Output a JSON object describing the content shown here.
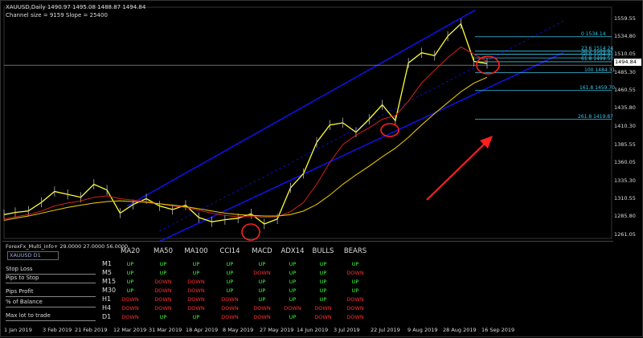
{
  "header": {
    "symbol_line": "XAUUSD,Daily  1490.97 1495.08 1488.87 1494.84",
    "channel_line": "Channel size = 9159 Slope = 25400"
  },
  "colors": {
    "price_line": "#ffff33",
    "ma_fast": "#d42020",
    "ma_slow": "#e0c000",
    "channel": "#1010e0",
    "fib": "#39c5e8",
    "annotation": "#ff2020",
    "up": "#33ff33",
    "down": "#ff3030"
  },
  "chart_data": {
    "type": "line",
    "title": "",
    "symbol": "XAUUSD",
    "timeframe": "Daily",
    "ohlc_last": {
      "open": 1490.97,
      "high": 1495.08,
      "low": 1488.87,
      "close": 1494.84
    },
    "current_price": "1494.84",
    "ylim": [
      1255,
      1575
    ],
    "y_ticks": [
      "1559.55",
      "1534.80",
      "1510.05",
      "1485.30",
      "1460.55",
      "1435.80",
      "1410.30",
      "1385.55",
      "1360.05",
      "1335.30",
      "1310.55",
      "1285.80",
      "1261.05"
    ],
    "x_ticks": [
      "1 Jan 2019",
      "3 Feb 2019",
      "21 Feb 2019",
      "12 Mar 2019",
      "31 Mar 2019",
      "18 Apr 2019",
      "8 May 2019",
      "27 May 2019",
      "14 Jun 2019",
      "3 Jul 2019",
      "22 Jul 2019",
      "9 Aug 2019",
      "28 Aug 2019",
      "16 Sep 2019"
    ],
    "x": [
      "2019-01-01",
      "2019-01-07",
      "2019-01-14",
      "2019-01-21",
      "2019-01-28",
      "2019-02-04",
      "2019-02-11",
      "2019-02-18",
      "2019-02-25",
      "2019-03-04",
      "2019-03-11",
      "2019-03-18",
      "2019-03-25",
      "2019-04-01",
      "2019-04-08",
      "2019-04-15",
      "2019-04-22",
      "2019-04-29",
      "2019-05-06",
      "2019-05-13",
      "2019-05-20",
      "2019-05-27",
      "2019-06-03",
      "2019-06-10",
      "2019-06-17",
      "2019-06-24",
      "2019-07-01",
      "2019-07-08",
      "2019-07-15",
      "2019-07-22",
      "2019-07-29",
      "2019-08-05",
      "2019-08-12",
      "2019-08-19",
      "2019-08-26",
      "2019-09-02",
      "2019-09-09",
      "2019-09-16"
    ],
    "series": [
      {
        "values": [
          1288,
          1291,
          1293,
          1305,
          1320,
          1316,
          1312,
          1330,
          1322,
          1290,
          1302,
          1310,
          1300,
          1295,
          1301,
          1284,
          1278,
          1281,
          1283,
          1289,
          1275,
          1282,
          1325,
          1345,
          1388,
          1412,
          1415,
          1402,
          1420,
          1440,
          1418,
          1498,
          1512,
          1508,
          1535,
          1552,
          1500,
          1497
        ]
      },
      {
        "values": [
          1282,
          1285,
          1288,
          1293,
          1300,
          1304,
          1307,
          1312,
          1314,
          1310,
          1308,
          1306,
          1303,
          1300,
          1298,
          1294,
          1290,
          1287,
          1285,
          1286,
          1284,
          1285,
          1292,
          1305,
          1330,
          1360,
          1385,
          1398,
          1408,
          1420,
          1425,
          1445,
          1470,
          1488,
          1505,
          1520,
          1510,
          1500
        ]
      },
      {
        "values": [
          1280,
          1283,
          1286,
          1290,
          1294,
          1298,
          1301,
          1304,
          1306,
          1307,
          1306,
          1305,
          1303,
          1301,
          1299,
          1296,
          1293,
          1290,
          1288,
          1287,
          1286,
          1286,
          1288,
          1293,
          1302,
          1315,
          1330,
          1343,
          1355,
          1368,
          1380,
          1395,
          1412,
          1428,
          1443,
          1458,
          1470,
          1478
        ]
      }
    ],
    "fibonacci": [
      {
        "label": "0 1534.14",
        "value": 1534.14
      },
      {
        "label": "23.6 1514.24",
        "value": 1514.24
      },
      {
        "label": "38.2 1509.92",
        "value": 1509.92
      },
      {
        "label": "50.0 1504.83",
        "value": 1504.83
      },
      {
        "label": "61.8 1499.53",
        "value": 1499.53
      },
      {
        "label": "100 1484.31",
        "value": 1484.31
      },
      {
        "label": "161.8 1459.70",
        "value": 1459.7
      },
      {
        "label": "261.8 1419.87",
        "value": 1419.87
      }
    ],
    "channel": {
      "start_x": "2019-03-25",
      "start_low": 1230,
      "start_high": 1300,
      "end_x": "2019-09-16",
      "end_low": 1490,
      "end_high": 1582
    }
  },
  "indicator_panel": {
    "title": "ForexFx_Multi_info+ 29.0000 27.0000 56.0000",
    "symbol": "XAUUSD D1",
    "side_labels": [
      "Stop Loss",
      "Pips to Stop",
      "Pips Profit",
      "% of Balance",
      "Max lot to trade"
    ],
    "columns": [
      "MA20",
      "MA50",
      "MA100",
      "CCI14",
      "MACD",
      "ADX14",
      "BULLS",
      "BEARS"
    ],
    "rows": [
      {
        "tf": "M1",
        "values": [
          "UP",
          "UP",
          "UP",
          "UP",
          "UP",
          "UP",
          "UP",
          "UP"
        ]
      },
      {
        "tf": "M5",
        "values": [
          "UP",
          "UP",
          "UP",
          "UP",
          "DOWN",
          "UP",
          "UP",
          "DOWN"
        ]
      },
      {
        "tf": "M15",
        "values": [
          "UP",
          "DOWN",
          "DOWN",
          "UP",
          "UP",
          "UP",
          "UP",
          "UP"
        ]
      },
      {
        "tf": "M30",
        "values": [
          "UP",
          "DOWN",
          "DOWN",
          "UP",
          "UP",
          "UP",
          "UP",
          "UP"
        ]
      },
      {
        "tf": "H1",
        "values": [
          "DOWN",
          "DOWN",
          "DOWN",
          "DOWN",
          "UP",
          "UP",
          "UP",
          "DOWN"
        ]
      },
      {
        "tf": "H4",
        "values": [
          "DOWN",
          "DOWN",
          "DOWN",
          "DOWN",
          "DOWN",
          "DOWN",
          "DOWN",
          "DOWN"
        ]
      },
      {
        "tf": "D1",
        "values": [
          "DOWN",
          "UP",
          "UP",
          "DOWN",
          "DOWN",
          "UP",
          "DOWN",
          "DOWN"
        ]
      }
    ]
  }
}
